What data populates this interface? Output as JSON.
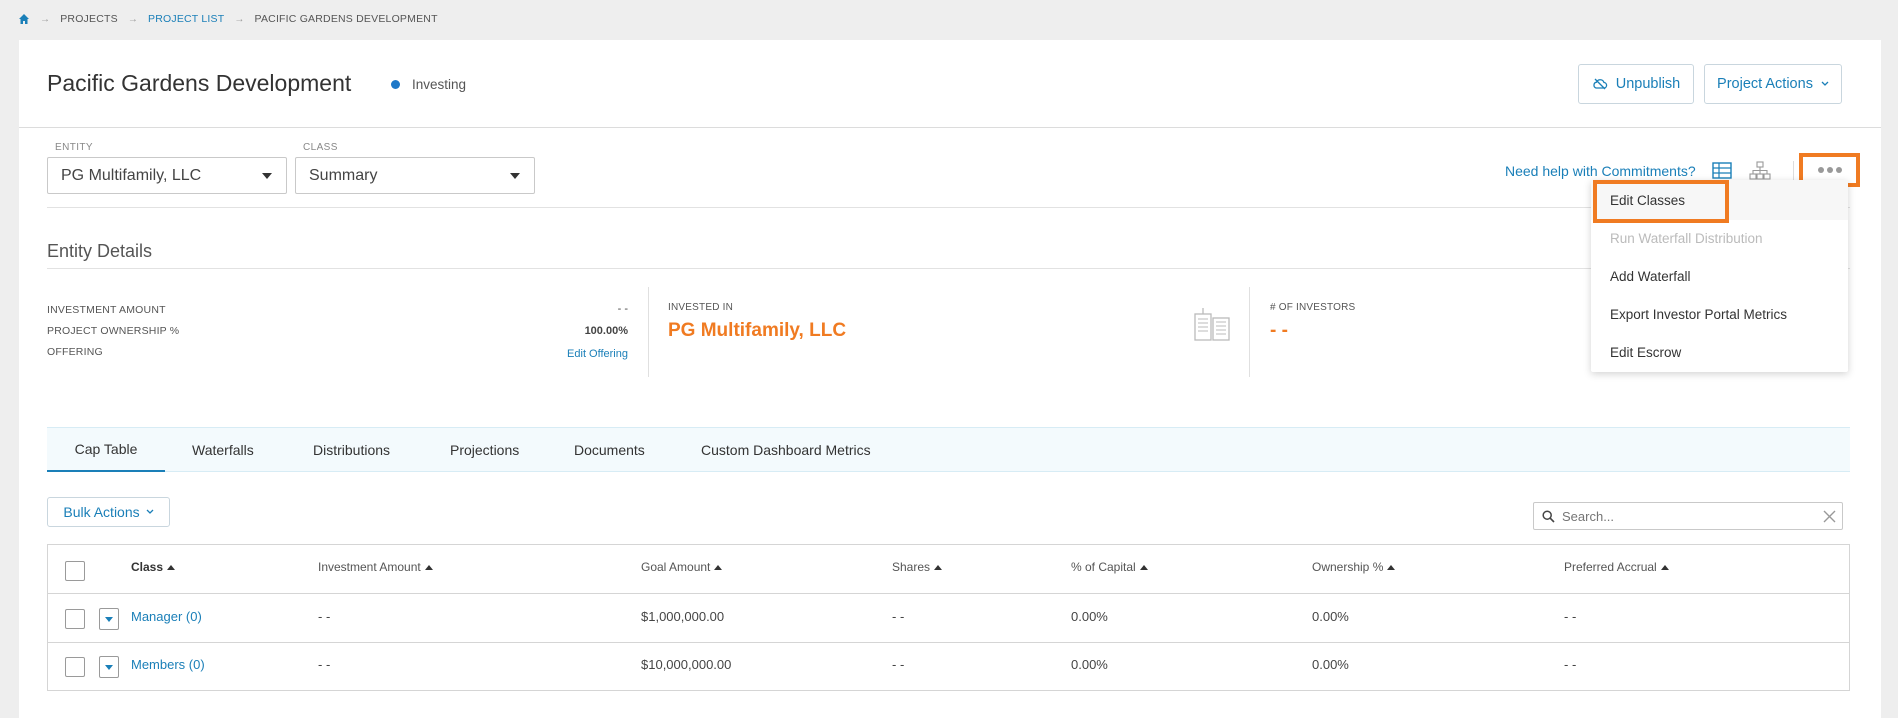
{
  "breadcrumb": {
    "home_icon": "home-icon",
    "items": [
      "PROJECTS",
      "PROJECT LIST",
      "PACIFIC GARDENS DEVELOPMENT"
    ]
  },
  "page": {
    "title": "Pacific Gardens Development",
    "status": "Investing",
    "status_color": "#1e78c8"
  },
  "header_actions": {
    "unpublish_label": "Unpublish",
    "project_actions_label": "Project Actions"
  },
  "filters": {
    "entity_label": "ENTITY",
    "entity_value": "PG Multifamily, LLC",
    "class_label": "CLASS",
    "class_value": "Summary"
  },
  "toolbar": {
    "help_link": "Need help with Commitments?",
    "table_view_icon": "table-view-icon",
    "hierarchy_view_icon": "hierarchy-icon",
    "more_icon": "more-options-icon"
  },
  "more_menu": {
    "items": [
      {
        "label": "Edit Classes",
        "enabled": true
      },
      {
        "label": "Run Waterfall Distribution",
        "enabled": false
      },
      {
        "label": "Add Waterfall",
        "enabled": true
      },
      {
        "label": "Export Investor Portal Metrics",
        "enabled": true
      },
      {
        "label": "Edit Escrow",
        "enabled": true
      }
    ]
  },
  "entity_details": {
    "heading": "Entity Details",
    "investment_amount_label": "INVESTMENT AMOUNT",
    "investment_amount_value": "- -",
    "ownership_label": "PROJECT OWNERSHIP %",
    "ownership_value": "100.00%",
    "offering_label": "OFFERING",
    "offering_link": "Edit Offering",
    "invested_in_label": "INVESTED IN",
    "invested_in_value": "PG Multifamily, LLC",
    "investors_label": "# OF INVESTORS",
    "investors_value": "- -"
  },
  "tabs": [
    "Cap Table",
    "Waterfalls",
    "Distributions",
    "Projections",
    "Documents",
    "Custom Dashboard Metrics"
  ],
  "bulk_actions_label": "Bulk Actions",
  "search": {
    "placeholder": "Search..."
  },
  "cap_table": {
    "columns": [
      "Class",
      "Investment Amount",
      "Goal Amount",
      "Shares",
      "% of Capital",
      "Ownership %",
      "Preferred Accrual"
    ],
    "rows": [
      {
        "class": "Manager (0)",
        "investment_amount": "- -",
        "goal_amount": "$1,000,000.00",
        "shares": "- -",
        "capital_pct": "0.00%",
        "ownership_pct": "0.00%",
        "preferred_accrual": "- -"
      },
      {
        "class": "Members (0)",
        "investment_amount": "- -",
        "goal_amount": "$10,000,000.00",
        "shares": "- -",
        "capital_pct": "0.00%",
        "ownership_pct": "0.00%",
        "preferred_accrual": "- -"
      }
    ]
  },
  "colors": {
    "accent": "#1a7fb8",
    "highlight": "#f07b22",
    "invested_in": "#f07b22"
  }
}
